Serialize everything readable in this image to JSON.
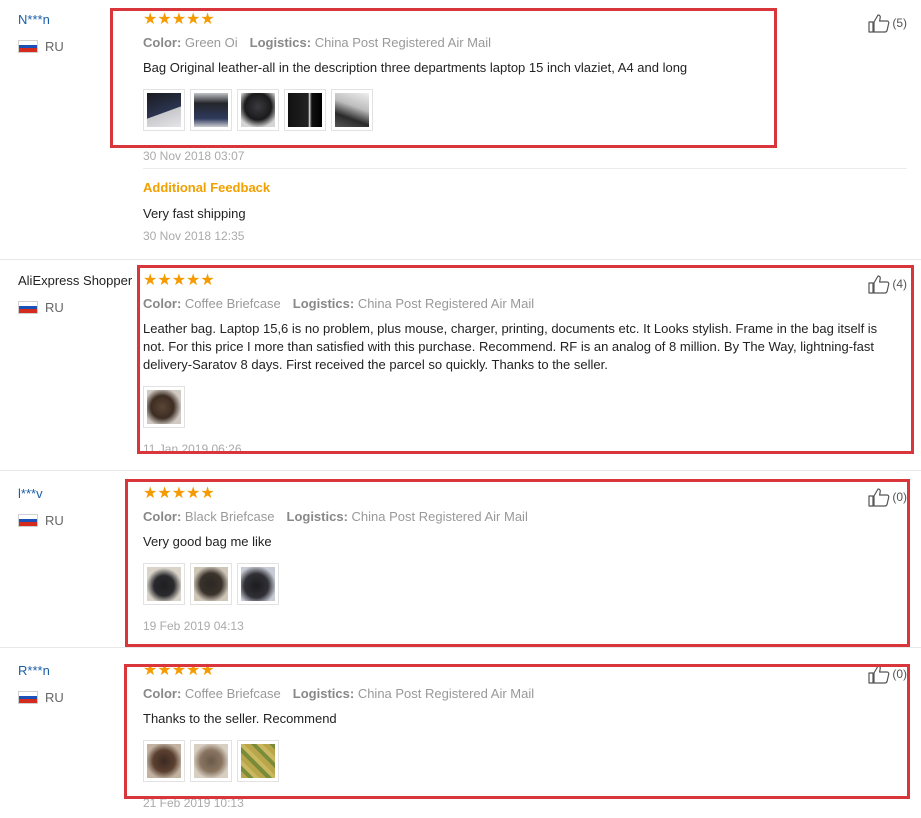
{
  "labels": {
    "color": "Color:",
    "logistics": "Logistics:",
    "additional_feedback": "Additional Feedback"
  },
  "colors": {
    "link": "#1a5ea8",
    "star": "#f59b00",
    "highlight_box": "#d9363b",
    "additional": "#f0a000"
  },
  "icons": {
    "like": "thumbs-up-icon",
    "flag": "russia-flag-icon",
    "star": "star-icon"
  },
  "reviews": [
    {
      "buyer": "N***n",
      "country": "RU",
      "stars": "★★★★★",
      "color_value": "Green Oi",
      "logistics_value": "China Post Registered Air Mail",
      "text": "Bag Original leather-all in the description three departments laptop 15 inch vlaziet, A4 and long",
      "date": "30 Nov 2018 03:07",
      "likes": "(5)",
      "photos": [
        "black leather bag photo",
        "dark bag photo",
        "bag with tag photo",
        "dark bag front photo",
        "bag side photo"
      ],
      "additional": {
        "text": "Very fast shipping",
        "date": "30 Nov 2018 12:35"
      }
    },
    {
      "buyer": "AliExpress Shopper",
      "country": "RU",
      "stars": "★★★★★",
      "color_value": "Coffee Briefcase",
      "logistics_value": "China Post Registered Air Mail",
      "text": "Leather bag. Laptop 15,6 is no problem, plus mouse, charger, printing, documents etc. It Looks stylish. Frame in the bag itself is not. For this price I more than satisfied with this purchase. Recommend. RF is an analog of 8 million. By The Way, lightning-fast delivery-Saratov 8 days. First received the parcel so quickly. Thanks to the seller.",
      "date": "11 Jan 2019 06:26",
      "likes": "(4)",
      "photos": [
        "brown bag photo"
      ]
    },
    {
      "buyer": "l***v",
      "country": "RU",
      "stars": "★★★★★",
      "color_value": "Black Briefcase",
      "logistics_value": "China Post Registered Air Mail",
      "text": "Very good bag me like",
      "date": "19 Feb 2019 04:13",
      "likes": "(0)",
      "photos": [
        "black bag photo",
        "black bag open photo",
        "black bag detail photo"
      ]
    },
    {
      "buyer": "R***n",
      "country": "RU",
      "stars": "★★★★★",
      "color_value": "Coffee Briefcase",
      "logistics_value": "China Post Registered Air Mail",
      "text": "Thanks to the seller. Recommend",
      "date": "21 Feb 2019 10:13",
      "likes": "(0)",
      "photos": [
        "brown bag photo",
        "brown bag top photo",
        "bag in package photo"
      ]
    }
  ]
}
